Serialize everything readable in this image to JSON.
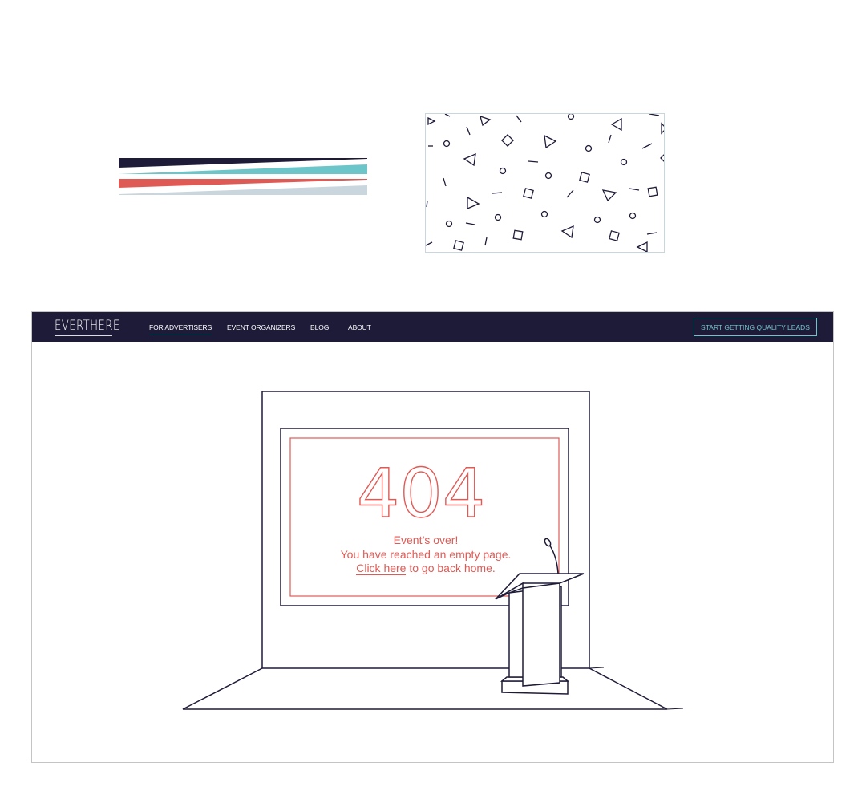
{
  "brand": {
    "logo_text": "EVERTHERE",
    "colors": {
      "navy": "#1e1b38",
      "teal": "#6cc6c9",
      "coral": "#e05a55",
      "light_blue_gray": "#c9d6de"
    }
  },
  "nav": {
    "items": [
      {
        "label": "FOR ADVERTISERS",
        "active": true
      },
      {
        "label": "EVENT ORGANIZERS",
        "active": false
      },
      {
        "label": "BLOG",
        "active": false
      },
      {
        "label": "ABOUT",
        "active": false
      }
    ],
    "cta_label": "START GETTING QUALITY LEADS"
  },
  "error": {
    "code": "404",
    "line1": "Event’s over!",
    "line2": "You have reached an empty page.",
    "link_text": "Click here",
    "line3_rest": " to go back home."
  },
  "decor": {
    "stripes_icon": "brand-stripes-icon",
    "pattern_icon": "confetti-pattern-icon",
    "podium_icon": "podium-icon",
    "microphone_icon": "microphone-icon"
  }
}
